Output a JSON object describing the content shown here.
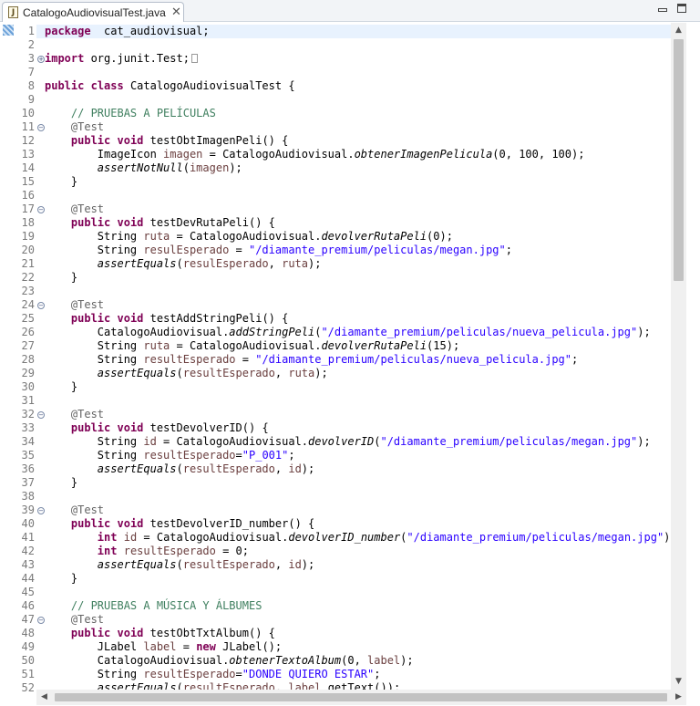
{
  "tab": {
    "title": "CatalogoAudiovisualTest.java",
    "file_icon": "java-file-icon",
    "close_glyph": "✕"
  },
  "window_controls": {
    "minimize": "minimize-icon",
    "maximize": "maximize-icon"
  },
  "scrollbars": {
    "up": "▲",
    "down": "▼",
    "left": "◀",
    "right": "▶"
  },
  "editor": {
    "current_line": 1,
    "lines": [
      {
        "n": "1",
        "fold": "",
        "segs": [
          [
            "kw",
            "package"
          ],
          [
            "",
            "  cat_audiovisual;"
          ]
        ]
      },
      {
        "n": "2",
        "fold": "",
        "segs": []
      },
      {
        "n": "3",
        "fold": "plus",
        "segs": [
          [
            "kw",
            "import"
          ],
          [
            "",
            " org.junit.Test;"
          ]
        ],
        "folded": true
      },
      {
        "n": "7",
        "fold": "",
        "segs": []
      },
      {
        "n": "8",
        "fold": "",
        "segs": [
          [
            "kw",
            "public"
          ],
          [
            "",
            " "
          ],
          [
            "kw",
            "class"
          ],
          [
            "",
            " CatalogoAudiovisualTest {"
          ]
        ]
      },
      {
        "n": "9",
        "fold": "",
        "segs": []
      },
      {
        "n": "10",
        "fold": "",
        "segs": [
          [
            "",
            "    "
          ],
          [
            "cm",
            "// PRUEBAS A PELÍCULAS"
          ]
        ]
      },
      {
        "n": "11",
        "fold": "minus",
        "segs": [
          [
            "",
            "    "
          ],
          [
            "an",
            "@Test"
          ]
        ]
      },
      {
        "n": "12",
        "fold": "",
        "segs": [
          [
            "",
            "    "
          ],
          [
            "kw",
            "public"
          ],
          [
            "",
            " "
          ],
          [
            "kw",
            "void"
          ],
          [
            "",
            " testObtImagenPeli() {"
          ]
        ]
      },
      {
        "n": "13",
        "fold": "",
        "segs": [
          [
            "",
            "        ImageIcon "
          ],
          [
            "lv",
            "imagen"
          ],
          [
            "",
            " = CatalogoAudiovisual."
          ],
          [
            "it",
            "obtenerImagenPelicula"
          ],
          [
            "",
            "(0, 100, 100);"
          ]
        ]
      },
      {
        "n": "14",
        "fold": "",
        "segs": [
          [
            "",
            "        "
          ],
          [
            "it",
            "assertNotNull"
          ],
          [
            "",
            "("
          ],
          [
            "lv",
            "imagen"
          ],
          [
            "",
            ");"
          ]
        ]
      },
      {
        "n": "15",
        "fold": "",
        "segs": [
          [
            "",
            "    }"
          ]
        ]
      },
      {
        "n": "16",
        "fold": "",
        "segs": []
      },
      {
        "n": "17",
        "fold": "minus",
        "segs": [
          [
            "",
            "    "
          ],
          [
            "an",
            "@Test"
          ]
        ]
      },
      {
        "n": "18",
        "fold": "",
        "segs": [
          [
            "",
            "    "
          ],
          [
            "kw",
            "public"
          ],
          [
            "",
            " "
          ],
          [
            "kw",
            "void"
          ],
          [
            "",
            " testDevRutaPeli() {"
          ]
        ]
      },
      {
        "n": "19",
        "fold": "",
        "segs": [
          [
            "",
            "        String "
          ],
          [
            "lv",
            "ruta"
          ],
          [
            "",
            " = CatalogoAudiovisual."
          ],
          [
            "it",
            "devolverRutaPeli"
          ],
          [
            "",
            "(0);"
          ]
        ]
      },
      {
        "n": "20",
        "fold": "",
        "segs": [
          [
            "",
            "        String "
          ],
          [
            "lv",
            "resulEsperado"
          ],
          [
            "",
            " = "
          ],
          [
            "st",
            "\"/diamante_premium/peliculas/megan.jpg\""
          ],
          [
            "",
            ";"
          ]
        ]
      },
      {
        "n": "21",
        "fold": "",
        "segs": [
          [
            "",
            "        "
          ],
          [
            "it",
            "assertEquals"
          ],
          [
            "",
            "("
          ],
          [
            "lv",
            "resulEsperado"
          ],
          [
            "",
            ", "
          ],
          [
            "lv",
            "ruta"
          ],
          [
            "",
            ");"
          ]
        ]
      },
      {
        "n": "22",
        "fold": "",
        "segs": [
          [
            "",
            "    }"
          ]
        ]
      },
      {
        "n": "23",
        "fold": "",
        "segs": []
      },
      {
        "n": "24",
        "fold": "minus",
        "segs": [
          [
            "",
            "    "
          ],
          [
            "an",
            "@Test"
          ]
        ]
      },
      {
        "n": "25",
        "fold": "",
        "segs": [
          [
            "",
            "    "
          ],
          [
            "kw",
            "public"
          ],
          [
            "",
            " "
          ],
          [
            "kw",
            "void"
          ],
          [
            "",
            " testAddStringPeli() {"
          ]
        ]
      },
      {
        "n": "26",
        "fold": "",
        "segs": [
          [
            "",
            "        CatalogoAudiovisual."
          ],
          [
            "it",
            "addStringPeli"
          ],
          [
            "",
            "("
          ],
          [
            "st",
            "\"/diamante_premium/peliculas/nueva_pelicula.jpg\""
          ],
          [
            "",
            ");"
          ]
        ]
      },
      {
        "n": "27",
        "fold": "",
        "segs": [
          [
            "",
            "        String "
          ],
          [
            "lv",
            "ruta"
          ],
          [
            "",
            " = CatalogoAudiovisual."
          ],
          [
            "it",
            "devolverRutaPeli"
          ],
          [
            "",
            "(15);"
          ]
        ]
      },
      {
        "n": "28",
        "fold": "",
        "segs": [
          [
            "",
            "        String "
          ],
          [
            "lv",
            "resultEsperado"
          ],
          [
            "",
            " = "
          ],
          [
            "st",
            "\"/diamante_premium/peliculas/nueva_pelicula.jpg\""
          ],
          [
            "",
            ";"
          ]
        ]
      },
      {
        "n": "29",
        "fold": "",
        "segs": [
          [
            "",
            "        "
          ],
          [
            "it",
            "assertEquals"
          ],
          [
            "",
            "("
          ],
          [
            "lv",
            "resultEsperado"
          ],
          [
            "",
            ", "
          ],
          [
            "lv",
            "ruta"
          ],
          [
            "",
            ");"
          ]
        ]
      },
      {
        "n": "30",
        "fold": "",
        "segs": [
          [
            "",
            "    }"
          ]
        ]
      },
      {
        "n": "31",
        "fold": "",
        "segs": []
      },
      {
        "n": "32",
        "fold": "minus",
        "segs": [
          [
            "",
            "    "
          ],
          [
            "an",
            "@Test"
          ]
        ]
      },
      {
        "n": "33",
        "fold": "",
        "segs": [
          [
            "",
            "    "
          ],
          [
            "kw",
            "public"
          ],
          [
            "",
            " "
          ],
          [
            "kw",
            "void"
          ],
          [
            "",
            " testDevolverID() {"
          ]
        ]
      },
      {
        "n": "34",
        "fold": "",
        "segs": [
          [
            "",
            "        String "
          ],
          [
            "lv",
            "id"
          ],
          [
            "",
            " = CatalogoAudiovisual."
          ],
          [
            "it",
            "devolverID"
          ],
          [
            "",
            "("
          ],
          [
            "st",
            "\"/diamante_premium/peliculas/megan.jpg\""
          ],
          [
            "",
            ");"
          ]
        ]
      },
      {
        "n": "35",
        "fold": "",
        "segs": [
          [
            "",
            "        String "
          ],
          [
            "lv",
            "resultEsperado"
          ],
          [
            "",
            "="
          ],
          [
            "st",
            "\"P_001\""
          ],
          [
            "",
            ";"
          ]
        ]
      },
      {
        "n": "36",
        "fold": "",
        "segs": [
          [
            "",
            "        "
          ],
          [
            "it",
            "assertEquals"
          ],
          [
            "",
            "("
          ],
          [
            "lv",
            "resultEsperado"
          ],
          [
            "",
            ", "
          ],
          [
            "lv",
            "id"
          ],
          [
            "",
            ");"
          ]
        ]
      },
      {
        "n": "37",
        "fold": "",
        "segs": [
          [
            "",
            "    }"
          ]
        ]
      },
      {
        "n": "38",
        "fold": "",
        "segs": []
      },
      {
        "n": "39",
        "fold": "minus",
        "segs": [
          [
            "",
            "    "
          ],
          [
            "an",
            "@Test"
          ]
        ]
      },
      {
        "n": "40",
        "fold": "",
        "segs": [
          [
            "",
            "    "
          ],
          [
            "kw",
            "public"
          ],
          [
            "",
            " "
          ],
          [
            "kw",
            "void"
          ],
          [
            "",
            " testDevolverID_number() {"
          ]
        ]
      },
      {
        "n": "41",
        "fold": "",
        "segs": [
          [
            "",
            "        "
          ],
          [
            "kw",
            "int"
          ],
          [
            "",
            " "
          ],
          [
            "lv",
            "id"
          ],
          [
            "",
            " = CatalogoAudiovisual."
          ],
          [
            "it",
            "devolverID_number"
          ],
          [
            "",
            "("
          ],
          [
            "st",
            "\"/diamante_premium/peliculas/megan.jpg\""
          ],
          [
            "",
            ");"
          ]
        ]
      },
      {
        "n": "42",
        "fold": "",
        "segs": [
          [
            "",
            "        "
          ],
          [
            "kw",
            "int"
          ],
          [
            "",
            " "
          ],
          [
            "lv",
            "resultEsperado"
          ],
          [
            "",
            " = 0;"
          ]
        ]
      },
      {
        "n": "43",
        "fold": "",
        "segs": [
          [
            "",
            "        "
          ],
          [
            "it",
            "assertEquals"
          ],
          [
            "",
            "("
          ],
          [
            "lv",
            "resultEsperado"
          ],
          [
            "",
            ", "
          ],
          [
            "lv",
            "id"
          ],
          [
            "",
            ");"
          ]
        ]
      },
      {
        "n": "44",
        "fold": "",
        "segs": [
          [
            "",
            "    }"
          ]
        ]
      },
      {
        "n": "45",
        "fold": "",
        "segs": []
      },
      {
        "n": "46",
        "fold": "",
        "segs": [
          [
            "",
            "    "
          ],
          [
            "cm",
            "// PRUEBAS A MÚSICA Y ÁLBUMES"
          ]
        ]
      },
      {
        "n": "47",
        "fold": "minus",
        "segs": [
          [
            "",
            "    "
          ],
          [
            "an",
            "@Test"
          ]
        ]
      },
      {
        "n": "48",
        "fold": "",
        "segs": [
          [
            "",
            "    "
          ],
          [
            "kw",
            "public"
          ],
          [
            "",
            " "
          ],
          [
            "kw",
            "void"
          ],
          [
            "",
            " testObtTxtAlbum() {"
          ]
        ]
      },
      {
        "n": "49",
        "fold": "",
        "segs": [
          [
            "",
            "        JLabel "
          ],
          [
            "lv",
            "label"
          ],
          [
            "",
            " = "
          ],
          [
            "kw",
            "new"
          ],
          [
            "",
            " JLabel();"
          ]
        ]
      },
      {
        "n": "50",
        "fold": "",
        "segs": [
          [
            "",
            "        CatalogoAudiovisual."
          ],
          [
            "it",
            "obtenerTextoAlbum"
          ],
          [
            "",
            "(0, "
          ],
          [
            "lv",
            "label"
          ],
          [
            "",
            ");"
          ]
        ]
      },
      {
        "n": "51",
        "fold": "",
        "segs": [
          [
            "",
            "        String "
          ],
          [
            "lv",
            "resultEsperado"
          ],
          [
            "",
            "="
          ],
          [
            "st",
            "\"DONDE QUIERO ESTAR\""
          ],
          [
            "",
            ";"
          ]
        ]
      },
      {
        "n": "52",
        "fold": "",
        "segs": [
          [
            "",
            "        "
          ],
          [
            "it",
            "assertEquals"
          ],
          [
            "",
            "("
          ],
          [
            "lv",
            "resultEsperado"
          ],
          [
            "",
            ", "
          ],
          [
            "lv",
            "label"
          ],
          [
            "",
            ".getText());"
          ]
        ]
      }
    ]
  }
}
